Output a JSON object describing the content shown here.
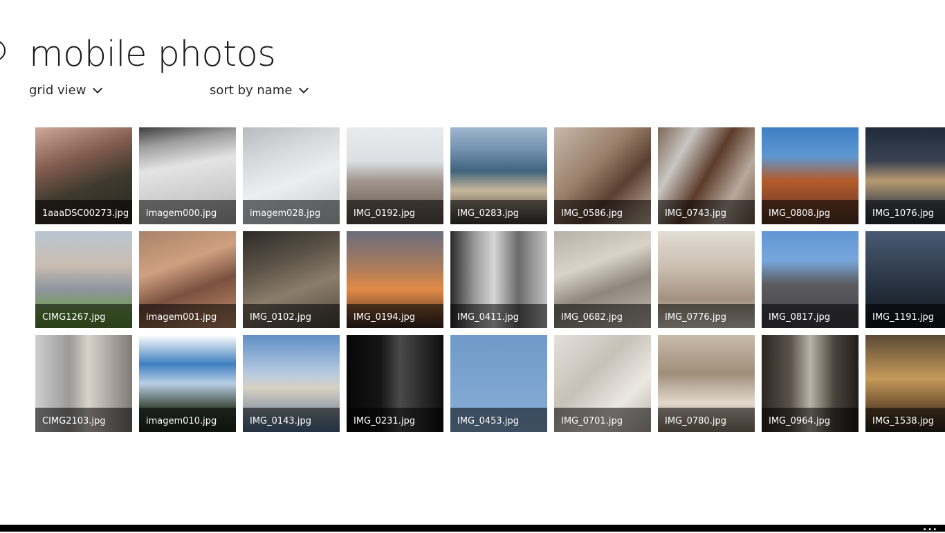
{
  "header": {
    "title": "mobile photos"
  },
  "view_menu": {
    "label": "grid view"
  },
  "sort_menu": {
    "label": "sort by name"
  },
  "tiles": [
    {
      "name": "1aaaDSC00273.jpg",
      "bg": "linear-gradient(160deg,#cfa99b 0%,#7f5a4d 35%,#3f3a2e 60%,#262520 100%)"
    },
    {
      "name": "imagem000.jpg",
      "bg": "linear-gradient(170deg,#3e3e3e 0%,#9d9d9d 18%,#e4e4e4 40%,#c9c9c9 75%,#a9a9a9 100%)"
    },
    {
      "name": "imagem028.jpg",
      "bg": "linear-gradient(160deg,#b9bcbf 0%,#d8dadc 30%,#eceef0 55%,#c5c8ca 100%)"
    },
    {
      "name": "IMG_0192.jpg",
      "bg": "linear-gradient(180deg,#e8ebee 0%,#dcdfe3 35%,#a39790 55%,#7a6d65 80%,#5c524d 100%)"
    },
    {
      "name": "IMG_0283.jpg",
      "bg": "linear-gradient(180deg,#9fb6cf 0%,#6f8eac 25%,#40637c 45%,#c7b79a 65%,#3a3a3c 100%)"
    },
    {
      "name": "IMG_0586.jpg",
      "bg": "linear-gradient(135deg,#c8b8aa 0%,#9a7f6b 40%,#5a3f31 65%,#cab9a6 100%)"
    },
    {
      "name": "IMG_0743.jpg",
      "bg": "linear-gradient(120deg,#7d6757 0%,#c9c6c2 25%,#5b3b2a 50%,#b8a99b 75%,#6e5747 100%)"
    },
    {
      "name": "IMG_0808.jpg",
      "bg": "linear-gradient(180deg,#3f7fc4 0%,#5e97d1 30%,#b45b2a 55%,#8b4a2b 75%,#5a3524 100%)"
    },
    {
      "name": "IMG_1076.jpg",
      "bg": "linear-gradient(180deg,#1f2b3a 0%,#3b4352 35%,#b69a6f 55%,#4b4d55 80%,#2a2e36 100%)"
    },
    {
      "name": "CIMG1267.jpg",
      "bg": "linear-gradient(180deg,#b9c6d2 0%,#c9bdb1 35%,#8f95a0 60%,#6ea04a 85%,#5b8c3a 100%)"
    },
    {
      "name": "imagem001.jpg",
      "bg": "linear-gradient(160deg,#a9836a 0%,#d0a080 35%,#7a5140 60%,#c68f6c 100%)"
    },
    {
      "name": "IMG_0102.jpg",
      "bg": "linear-gradient(160deg,#2c2a27 0%,#5e5549 35%,#8b7d6a 60%,#4e473f 100%)"
    },
    {
      "name": "IMG_0194.jpg",
      "bg": "linear-gradient(180deg,#6a6d7d 0%,#b07d5a 40%,#e28b46 60%,#3b2a22 100%)"
    },
    {
      "name": "IMG_0411.jpg",
      "bg": "linear-gradient(90deg,#2b2b2b 0%,#9a9a9a 25%,#d6d6d6 45%,#6a6a6a 70%,#c2c2c2 100%)"
    },
    {
      "name": "IMG_0682.jpg",
      "bg": "linear-gradient(160deg,#b7b0a6 0%,#d9d3c9 35%,#8f877c 60%,#c7bfb3 100%)"
    },
    {
      "name": "IMG_0776.jpg",
      "bg": "linear-gradient(180deg,#e3ddd4 0%,#c8bcae 40%,#a39180 70%,#ddd5ca 100%)"
    },
    {
      "name": "IMG_0817.jpg",
      "bg": "linear-gradient(180deg,#5f96d4 0%,#78a7dc 30%,#5b5b5e 55%,#444247 100%)"
    },
    {
      "name": "IMG_1191.jpg",
      "bg": "linear-gradient(180deg,#4a5a72 0%,#2e3a4c 45%,#101418 100%)"
    },
    {
      "name": "CIMG2103.jpg",
      "bg": "linear-gradient(90deg,#cfcfcf 0%,#9a9a9a 35%,#d9d2ca 55%,#7e7a75 100%)"
    },
    {
      "name": "imagem010.jpg",
      "bg": "linear-gradient(180deg,#ffffff 0%,#3f7fc0 30%,#b8cfe6 50%,#3d4a3c 75%,#1f2a22 100%)"
    },
    {
      "name": "IMG_0143.jpg",
      "bg": "linear-gradient(180deg,#5f8fc6 0%,#b7cbe0 40%,#d8d0c2 55%,#4e6c8f 100%)"
    },
    {
      "name": "IMG_0231.jpg",
      "bg": "linear-gradient(90deg,#070707 0%,#151515 35%,#4a4a4a 55%,#0e0e0e 100%)"
    },
    {
      "name": "IMG_0453.jpg",
      "bg": "linear-gradient(180deg,#6f9ac9 0%,#7ea6d1 60%,#88aed6 100%)"
    },
    {
      "name": "IMG_0701.jpg",
      "bg": "linear-gradient(135deg,#e4e0da 0%,#c7c1b8 40%,#ece8e2 70%,#b5afa6 100%)"
    },
    {
      "name": "IMG_0780.jpg",
      "bg": "linear-gradient(180deg,#c8bba9 0%,#9f8f7a 40%,#e2d9cc 70%,#8a7c6a 100%)"
    },
    {
      "name": "IMG_0964.jpg",
      "bg": "linear-gradient(90deg,#2c2722 0%,#5b544b 30%,#b9b3a8 50%,#4a433b 75%,#221e1a 100%)"
    },
    {
      "name": "IMG_1538.jpg",
      "bg": "linear-gradient(180deg,#5a4a34 0%,#c69a5a 45%,#7a5a35 70%,#2a2218 100%)"
    }
  ],
  "app_bar": {
    "more_glyph": "..."
  }
}
